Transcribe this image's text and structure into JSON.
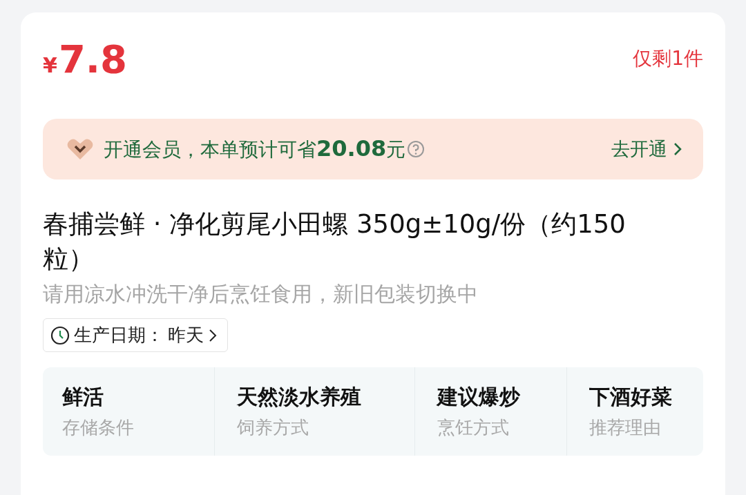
{
  "price": {
    "currency": "¥",
    "amount": "7.8"
  },
  "stock": "仅剩1件",
  "member_banner": {
    "text": "开通会员，本单预计可省**20.08**元",
    "action": "去开通"
  },
  "title": "春捕尝鲜 · 净化剪尾小田螺 350g±10g/份（约150粒）",
  "subtitle": "请用凉水冲洗干净后烹饪食用，新旧包装切换中",
  "production_date": {
    "label": "生产日期：",
    "value": "昨天"
  },
  "attributes": [
    {
      "value": "鲜活",
      "label": "存储条件"
    },
    {
      "value": "天然淡水养殖",
      "label": "饲养方式"
    },
    {
      "value": "建议爆炒",
      "label": "烹饪方式"
    },
    {
      "value": "下酒好菜",
      "label": "推荐理由"
    }
  ]
}
